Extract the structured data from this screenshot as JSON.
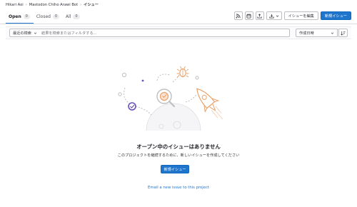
{
  "breadcrumb": {
    "items": [
      "Hikari Aoi",
      "Mastodon Chiho Arawi Bot",
      "イシュー"
    ],
    "separator": "›"
  },
  "tabs": [
    {
      "label": "Open",
      "count": "0"
    },
    {
      "label": "Closed",
      "count": "0"
    },
    {
      "label": "All",
      "count": "0"
    }
  ],
  "toolbar": {
    "rss_icon": "rss-icon",
    "calendar_icon": "calendar-icon",
    "export_icon": "export-icon",
    "import_icon": "import-icon",
    "bulk_edit_label": "イシューを編集",
    "new_issue_label": "新規イシュー"
  },
  "filter": {
    "recent_label": "最近の検索",
    "search_placeholder": "結果を検索またはフィルタする...",
    "sort_label": "作成日時"
  },
  "empty_state": {
    "title": "オープン中のイシューはありません",
    "description": "このプロジェクトを継続するために、新しいイシューを作成してください",
    "button_label": "新規イシュー",
    "email_link": "Email a new issue to this project"
  },
  "colors": {
    "primary": "#1f75cb",
    "illustration_orange": "#e9a26a",
    "illustration_purple": "#6b4fbb"
  }
}
